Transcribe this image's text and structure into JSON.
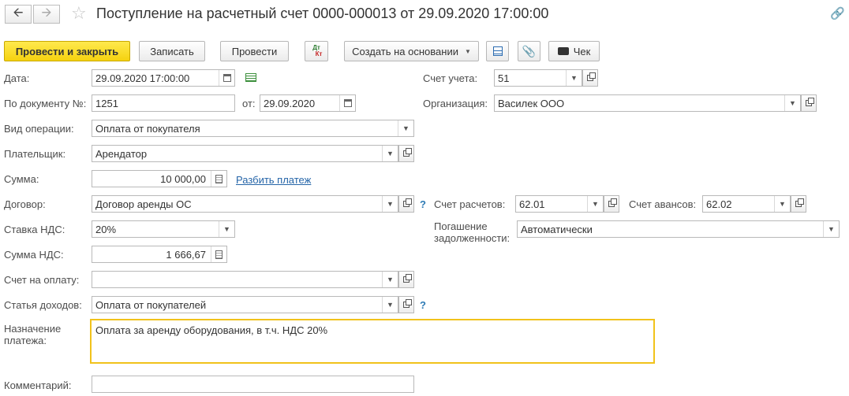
{
  "header": {
    "title": "Поступление на расчетный счет 0000-000013 от 29.09.2020 17:00:00",
    "back_icon": "arrow-left-icon",
    "forward_icon": "arrow-right-icon"
  },
  "toolbar": {
    "post_close": "Провести и закрыть",
    "save": "Записать",
    "post": "Провести",
    "dt_kt_top": "Дт",
    "dt_kt_bottom": "Кт",
    "create_based": "Создать на основании",
    "check": "Чек"
  },
  "form": {
    "date_label": "Дата:",
    "date_value": "29.09.2020 17:00:00",
    "doc_no_label": "По документу №:",
    "doc_no_value": "1251",
    "from_label": "от:",
    "from_value": "29.09.2020",
    "account_label": "Счет учета:",
    "account_value": "51",
    "org_label": "Организация:",
    "org_value": "Василек ООО",
    "operation_label": "Вид операции:",
    "operation_value": "Оплата от покупателя",
    "payer_label": "Плательщик:",
    "payer_value": "Арендатор",
    "amount_label": "Сумма:",
    "amount_value": "10 000,00",
    "split_link": "Разбить платеж",
    "contract_label": "Договор:",
    "contract_value": "Договор аренды ОС",
    "settle_acc_label": "Счет расчетов:",
    "settle_acc_value": "62.01",
    "adv_acc_label": "Счет авансов:",
    "adv_acc_value": "62.02",
    "vat_rate_label": "Ставка НДС:",
    "vat_rate_value": "20%",
    "repay_label_1": "Погашение",
    "repay_label_2": "задолженности:",
    "repay_value": "Автоматически",
    "vat_sum_label": "Сумма НДС:",
    "vat_sum_value": "1 666,67",
    "invoice_label": "Счет на оплату:",
    "invoice_value": "",
    "income_label": "Статья доходов:",
    "income_value": "Оплата от покупателей",
    "purpose_label_1": "Назначение",
    "purpose_label_2": "платежа:",
    "purpose_value": "Оплата за аренду оборудования, в т.ч. НДС 20%",
    "comment_label": "Комментарий:",
    "comment_value": "",
    "help_mark": "?"
  }
}
